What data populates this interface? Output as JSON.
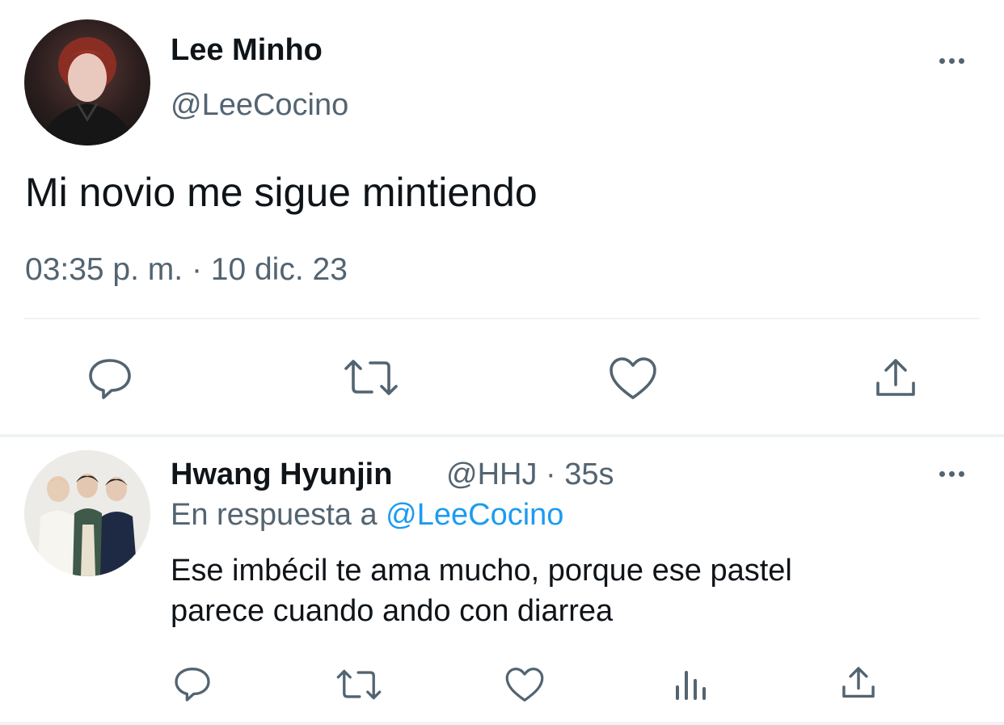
{
  "main_tweet": {
    "author_name": "Lee Minho",
    "author_handle": "@LeeCocino",
    "text": "Mi novio me sigue mintiendo",
    "timestamp": "03:35 p. m. · 10 dic. 23"
  },
  "reply": {
    "author_name": "Hwang Hyunjin",
    "meta": "@HHJ · 35s",
    "in_reply_prefix": "En respuesta a",
    "in_reply_handle": "@LeeCocino",
    "text_line1": "Ese imbécil te ama mucho, porque ese pastel",
    "text_line2": "parece cuando ando con diarrea"
  },
  "icons": {
    "more": "more-horizontal-icon",
    "reply": "reply-icon",
    "retweet": "retweet-icon",
    "like": "heart-icon",
    "views": "views-icon",
    "share": "share-icon"
  },
  "colors": {
    "text": "#0f1419",
    "secondary": "#536471",
    "link": "#1d9bf0",
    "divider": "#eff3f4"
  }
}
